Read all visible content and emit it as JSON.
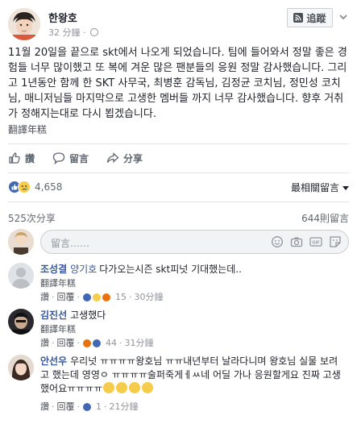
{
  "post": {
    "author_name": "한왕호",
    "time": "32 分鐘",
    "follow_label": "追蹤",
    "body": "11월 20일을 끝으로 skt에서 나오게 되었습니다. 팀에 들어와서 정말 좋은 경험들 너무 많이했고 또 복에 겨운 많은 팬분들의 응원 정말 감사했습니다. 그리고 1년동안 함께 한 SKT 사무국, 최병훈 감독님, 김정균 코치님, 정민성 코치님, 매니저님들 마지막으로 고생한 멤버들 까지 너무 감사했습니다. 향후 거취가 정해지는대로 다시 뵙겠습니다.",
    "see_translation": "翻譯年糕"
  },
  "actions": {
    "like": "讚",
    "comment": "留言",
    "share": "分享"
  },
  "stats": {
    "reaction_count": "4,658",
    "sort_label": "最相關留言",
    "shares": "525次分享",
    "comments": "644則留言"
  },
  "composer": {
    "placeholder": "留言……"
  },
  "comments": [
    {
      "name": "조성결",
      "tag": "양기호",
      "text": "다가오는시즌 skt피넛 기대했는데..",
      "translate": "翻譯年糕",
      "like": "讚",
      "reply": "回覆",
      "count": "15",
      "time": "30分鐘"
    },
    {
      "name": "김진선",
      "tag": "",
      "text": "고생했다",
      "translate": "翻譯年糕",
      "like": "讚",
      "reply": "回覆",
      "count": "44",
      "time": "31分鐘"
    },
    {
      "name": "안선우",
      "tag": "",
      "text": "우리넛 ㅠㅠㅠㅠ왕호님 ㅠㅠ내년부터 날라다니며 왕호님 실물 보려고 했는데 영영ㅇ ㅠㅠㅠㅠ술퍼죽게ㅔㅆ네 어딜 가나 응원할게요 진짜 고생했어요ㅠㅠㅠㅠ",
      "translate": "",
      "like": "讚",
      "reply": "回覆",
      "count": "1",
      "time": "21分鐘"
    }
  ],
  "colors": {
    "link": "#385898",
    "like_blue": "#4267b2",
    "sad_yellow": "#f6cc4b",
    "angry_orange": "#e9710f"
  }
}
